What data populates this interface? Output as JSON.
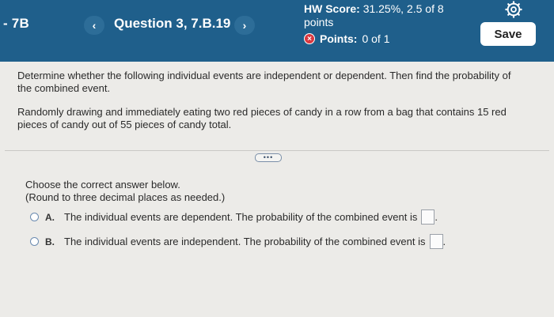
{
  "header": {
    "course": "- 7B",
    "prev_icon": "‹",
    "question_title": "Question 3, 7.B.19",
    "next_icon": "›",
    "hw_score_label": "HW Score:",
    "hw_score_value": "31.25%, 2.5 of 8",
    "hw_score_points": "points",
    "points_label": "Points:",
    "points_value": "0 of 1",
    "x_icon": "×",
    "save_label": "Save",
    "colors": {
      "header_bg": "#1f5f8b",
      "error_red": "#d9373f"
    }
  },
  "question": {
    "instruction": "Determine whether the following individual events are independent or dependent. Then find the probability of the combined event.",
    "scenario": "Randomly drawing and immediately eating two red pieces of candy in a row from a bag that contains 15 red pieces of candy out of 55 pieces of candy total.",
    "expand_icon": "•••"
  },
  "answer": {
    "prompt": "Choose the correct answer below.",
    "rounding_note": "(Round to three decimal places as needed.)",
    "choices": [
      {
        "letter": "A.",
        "text": "The individual events are dependent. The probability of the combined event is",
        "suffix": "."
      },
      {
        "letter": "B.",
        "text": "The individual events are independent. The probability of the combined event is",
        "suffix": "."
      }
    ]
  }
}
